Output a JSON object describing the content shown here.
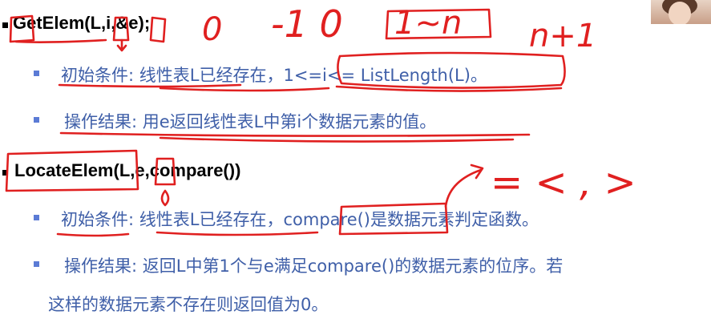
{
  "items": [
    {
      "heading": {
        "func": "GetElem",
        "args": "(L,i,&e);"
      },
      "init": {
        "label": "初始条件: ",
        "text": "线性表L已经存在，",
        "cond": "1<=i<= ListLength(L)",
        "tail": "。"
      },
      "result": {
        "label": "操作结果: ",
        "text": "用e返回线性表L中第i个数据元素的值。"
      }
    },
    {
      "heading": {
        "func": "LocateElem",
        "args": "(L,e,compare())"
      },
      "init": {
        "label": "初始条件: ",
        "text": "线性表L已经存在，",
        "cond": "compare()",
        "tail": "是数据元素判定函数。"
      },
      "result": {
        "label": "操作结果: ",
        "text": "返回L中第1个与e满足compare()的数据元素的位序。若",
        "text2": "这样的数据元素不存在则返回值为0。"
      }
    }
  ],
  "handwriting": {
    "marks_1": "-1 0",
    "marks_2": "1~n",
    "marks_3": "n+1",
    "marks_4": "= < , >",
    "digit_0": "0"
  },
  "colors": {
    "ink": "#e02020",
    "heading": "#000000",
    "label": "#3f5fa8",
    "bullet": "#5b7bd5"
  }
}
